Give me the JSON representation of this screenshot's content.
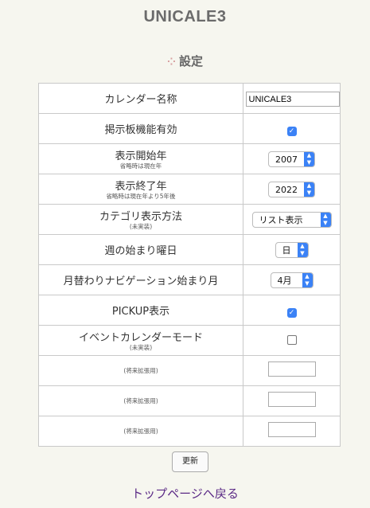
{
  "app_title": "UNICALE3",
  "section_title": "設定",
  "section_icon": "dots-icon",
  "rows": [
    {
      "label": "カレンダー名称",
      "sub": "",
      "control": "text",
      "value": "UNICALE3"
    },
    {
      "label": "掲示板機能有効",
      "sub": "",
      "control": "checkbox",
      "checked": true
    },
    {
      "label": "表示開始年",
      "sub": "省略時は現在年",
      "control": "select",
      "value": "2007"
    },
    {
      "label": "表示終了年",
      "sub": "省略時は現在年より5年後",
      "control": "select",
      "value": "2022"
    },
    {
      "label": "カテゴリ表示方法",
      "sub": "(未実装)",
      "control": "select",
      "value": "リスト表示"
    },
    {
      "label": "週の始まり曜日",
      "sub": "",
      "control": "select",
      "value": "日"
    },
    {
      "label": "月替わりナビゲーション始まり月",
      "sub": "",
      "control": "select",
      "value": "4月"
    },
    {
      "label": "PICKUP表示",
      "sub": "",
      "control": "checkbox",
      "checked": true
    },
    {
      "label": "イベントカレンダーモード",
      "sub": "(未実装)",
      "control": "checkbox",
      "checked": false
    },
    {
      "label": "",
      "sub": "(将来拡張用)",
      "control": "text",
      "value": ""
    },
    {
      "label": "",
      "sub": "(将来拡張用)",
      "control": "text",
      "value": ""
    },
    {
      "label": "",
      "sub": "(将来拡張用)",
      "control": "text",
      "value": ""
    }
  ],
  "update_button": "更新",
  "back_link": "トップページへ戻る",
  "colors": {
    "accent": "#3b82f6",
    "link": "#5b2a86",
    "background": "#f6f6ef"
  }
}
